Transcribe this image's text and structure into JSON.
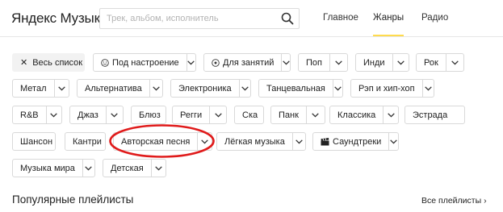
{
  "header": {
    "logo_part1": "Яндекс",
    "logo_part2": "Музыка",
    "search_placeholder": "Трек, альбом, исполнитель",
    "search_value": "",
    "nav": [
      "Главное",
      "Жанры",
      "Радио"
    ],
    "active_nav": "Жанры"
  },
  "filters": {
    "reset_label": "Весь список",
    "mood_label": "Под настроение",
    "activity_label": "Для занятий"
  },
  "genres": {
    "pop": "Поп",
    "indie": "Инди",
    "rock": "Рок",
    "metal": "Метал",
    "alternative": "Альтернатива",
    "electronic": "Электроника",
    "dance": "Танцевальная",
    "rap": "Рэп и хип-хоп",
    "rnb": "R&B",
    "jazz": "Джаз",
    "blues": "Блюз",
    "reggae": "Регги",
    "ska": "Ска",
    "punk": "Панк",
    "classical": "Классика",
    "estrada": "Эстрада",
    "chanson": "Шансон",
    "country": "Кантри",
    "bard": "Авторская песня",
    "easy": "Лёгкая музыка",
    "soundtracks": "Саундтреки",
    "world": "Музыка мира",
    "kids": "Детская"
  },
  "playlists": {
    "title": "Популярные плейлисты",
    "see_all": "Все плейлисты"
  },
  "colors": {
    "brand_red": "#ff0000",
    "active_underline": "#ffdb4d",
    "annotation_red": "#e01b1b"
  }
}
